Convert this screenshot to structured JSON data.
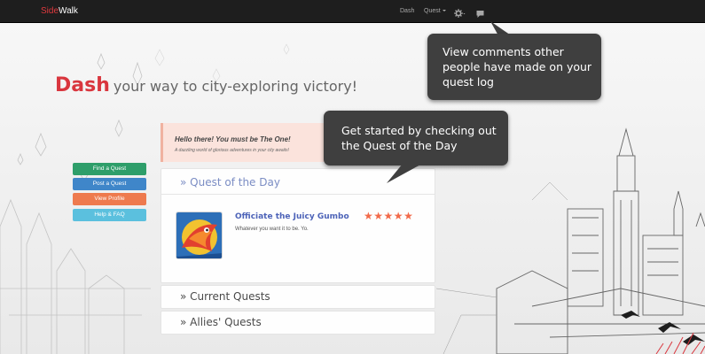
{
  "navbar": {
    "brand_part1": "Side",
    "brand_part2": "Walk",
    "dash_label": "Dash",
    "quest_label": "Quest",
    "settings_icon": "gear-icon",
    "comments_icon": "comment-icon"
  },
  "hero": {
    "highlight": "Dash",
    "rest": "your way to city-exploring victory!"
  },
  "sidebar": {
    "buttons": [
      {
        "label": "Find a Quest",
        "color": "#2e9e6a"
      },
      {
        "label": "Post a Quest",
        "color": "#3f86c9"
      },
      {
        "label": "View Profile",
        "color": "#ee7a4e"
      },
      {
        "label": "Help & FAQ",
        "color": "#5bc0de"
      }
    ]
  },
  "welcome": {
    "title": "Hello there! You must be The One!",
    "subtitle": "A dazzling world of glorious adventures in your city awaits!"
  },
  "quest_of_day": {
    "header": "» Quest of the Day",
    "title": "Officiate the Juicy Gumbo",
    "description": "Whatever you want it to be. Yo.",
    "rating": 5,
    "rating_max": 5,
    "star_color": "#f26a4a"
  },
  "current_quests": {
    "header": "» Current Quests"
  },
  "allies_quests": {
    "header": "» Allies' Quests"
  },
  "tooltips": {
    "comments": "View comments other people have made on your quest log",
    "quest_of_day": "Get started by checking out the Quest of the Day"
  },
  "colors": {
    "brand_red": "#e0393e",
    "headline_red": "#d9363e",
    "navbar": "#1e1e1e",
    "tooltip_bg": "#3f3f3f",
    "link_blue": "#4d63b8"
  }
}
